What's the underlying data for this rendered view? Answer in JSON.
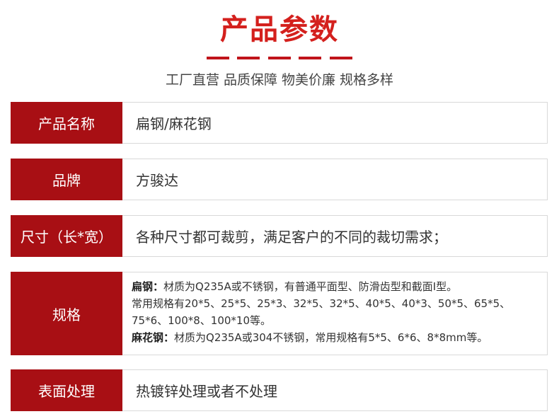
{
  "header": {
    "title": "产品参数",
    "subtitle": "工厂直营 品质保障 物美价廉 规格多样"
  },
  "rows": {
    "name": {
      "label": "产品名称",
      "value": "扁钢/麻花钢"
    },
    "brand": {
      "label": "品牌",
      "value": "方骏达"
    },
    "size": {
      "label": "尺寸（长*宽）",
      "value": "各种尺寸都可裁剪，满足客户的不同的裁切需求；"
    },
    "spec": {
      "label": "规格",
      "flat_title": "扁钢：",
      "flat_text1": "材质为Q235A或不锈钢，有普通平面型、防滑齿型和截面I型。",
      "flat_text2": "常用规格有20*5、25*5、25*3、32*5、32*5、40*5、40*3、50*5、65*5、",
      "flat_text3": "75*6、100*8、100*10等。",
      "twist_title": "麻花钢：",
      "twist_text": "材质为Q235A或304不锈钢，常用规格有5*5、6*6、8*8mm等。"
    },
    "surface": {
      "label": "表面处理",
      "value": "热镀锌处理或者不处理"
    }
  },
  "colors": {
    "title": "#d4201d",
    "label_bg": "#a80f14",
    "dash": "#c0141a"
  }
}
